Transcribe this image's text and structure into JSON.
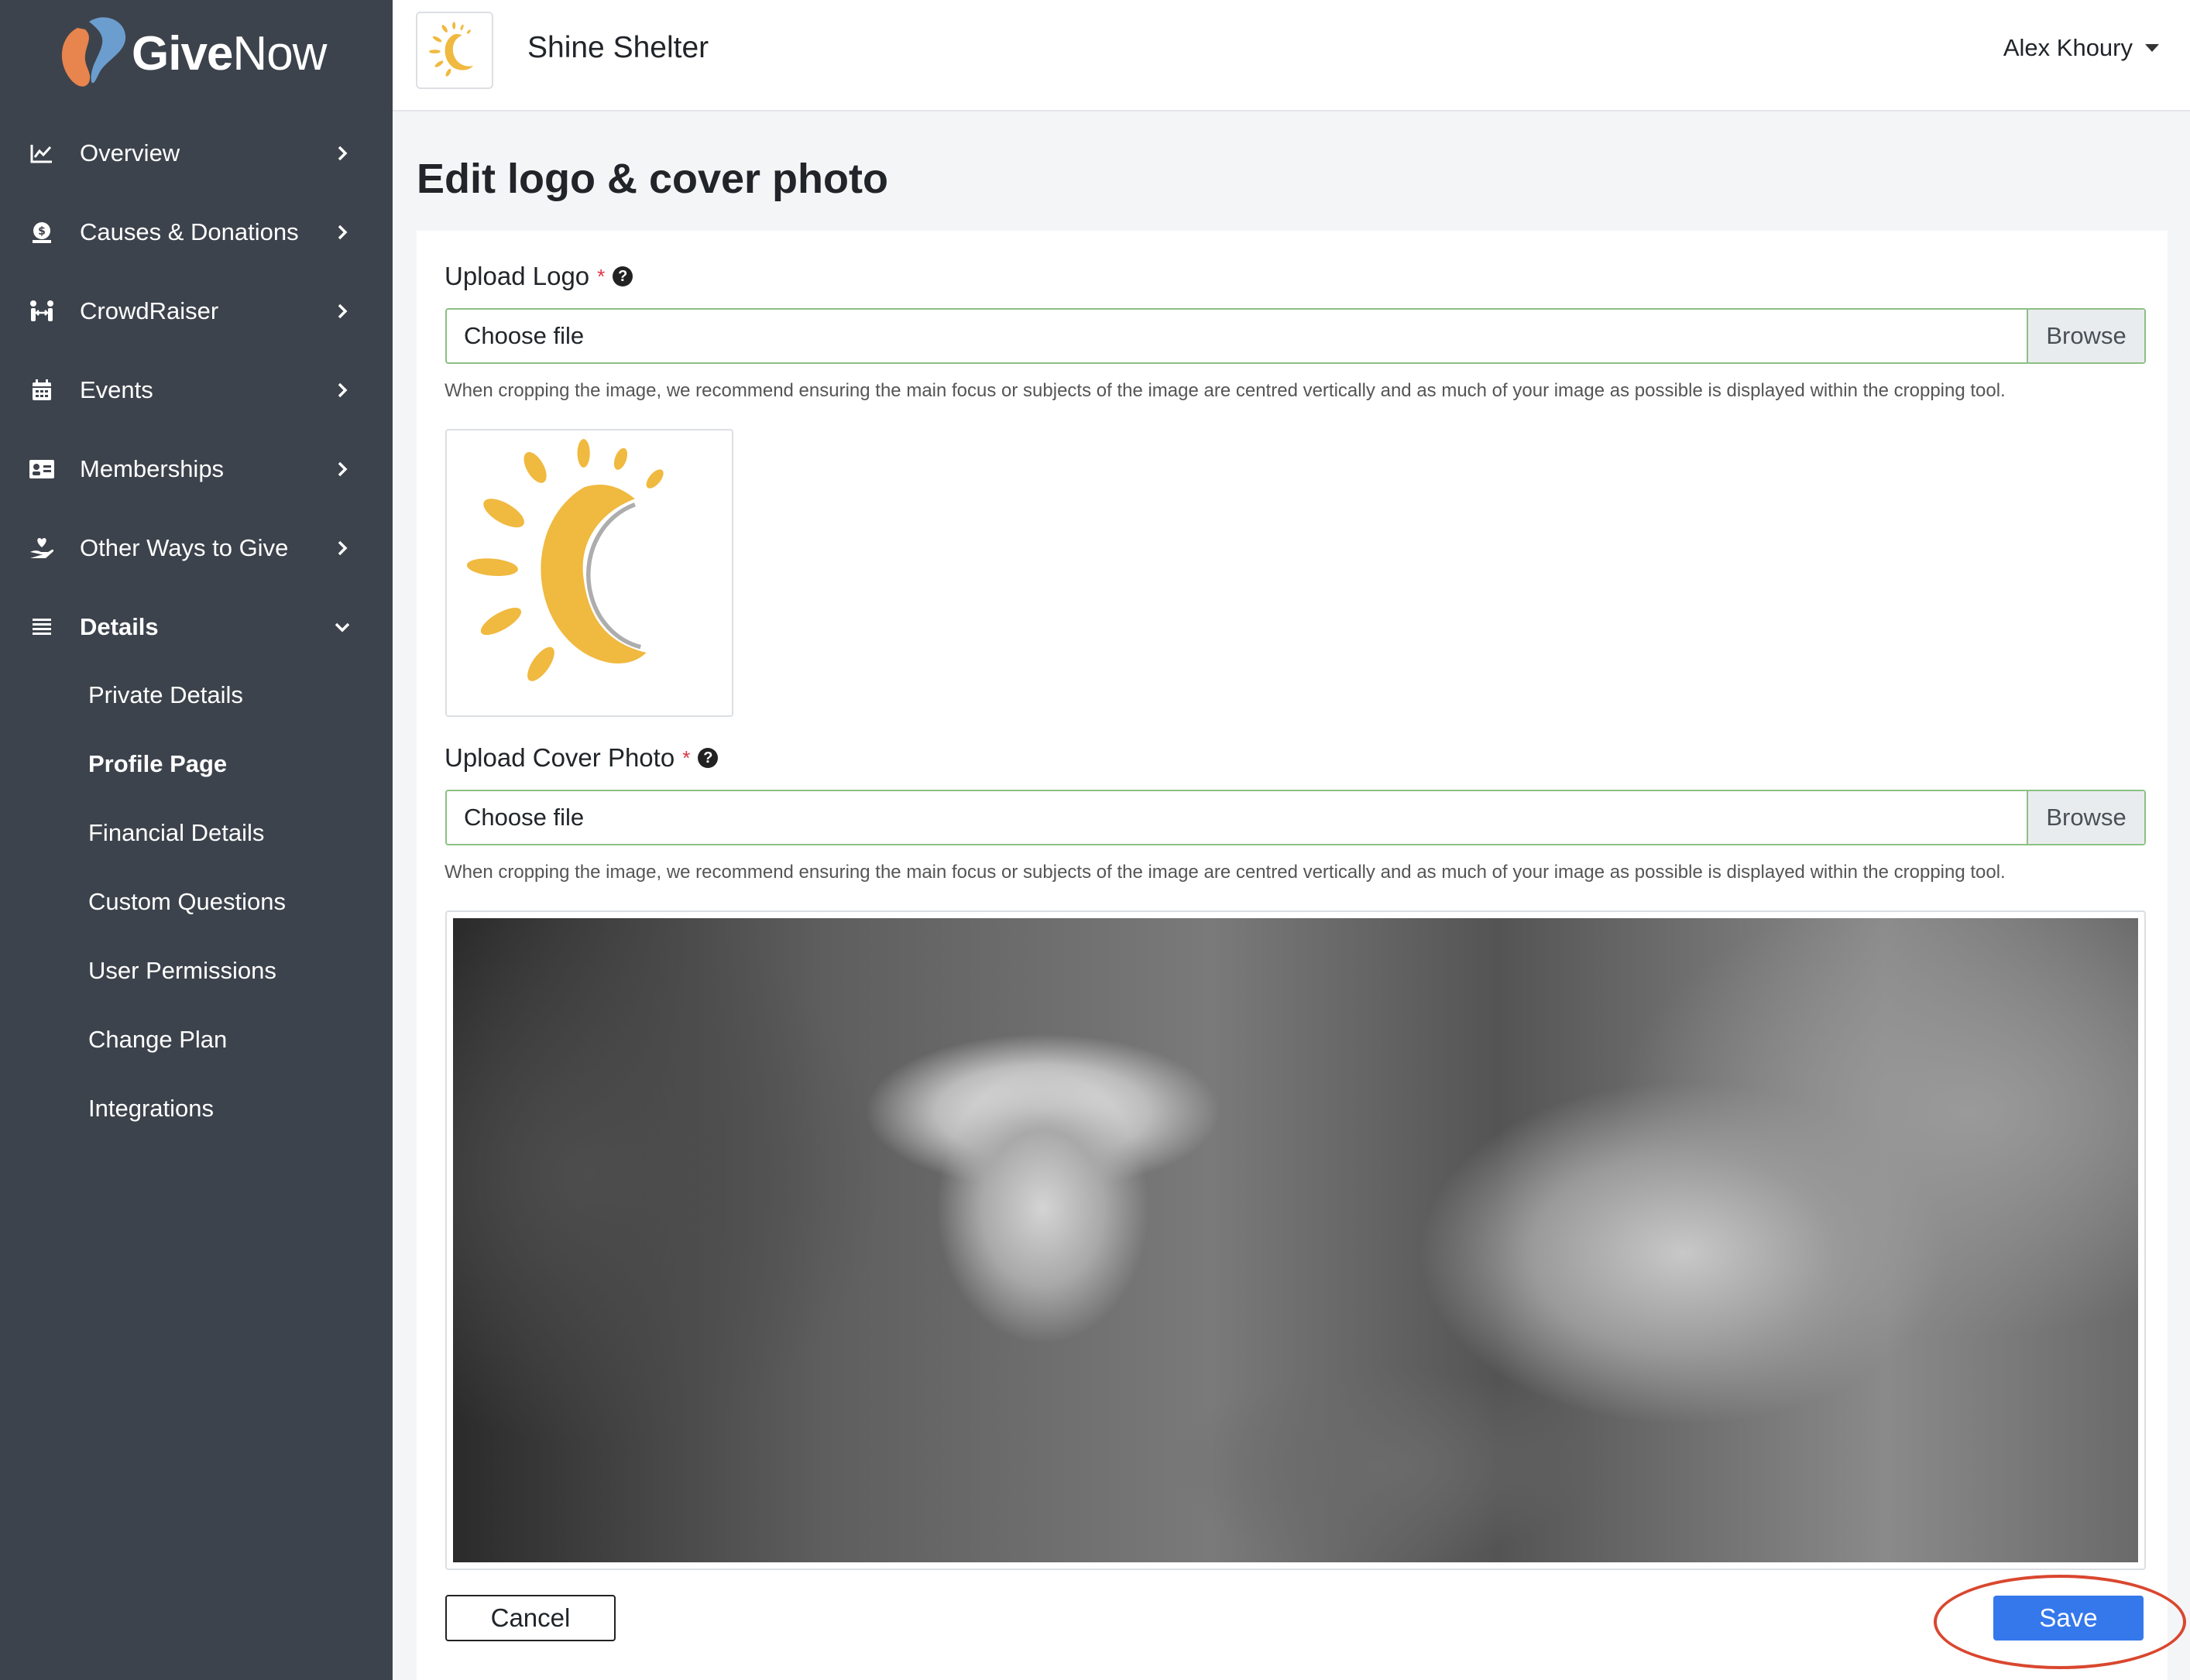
{
  "app": {
    "brand_bold": "Give",
    "brand_light": "Now",
    "org_name": "Shine Shelter",
    "user_name": "Alex Khoury"
  },
  "sidebar": {
    "items": [
      {
        "label": "Overview",
        "icon": "chart-line-icon"
      },
      {
        "label": "Causes & Donations",
        "icon": "money-bag-icon"
      },
      {
        "label": "CrowdRaiser",
        "icon": "people-arrows-icon"
      },
      {
        "label": "Events",
        "icon": "calendar-icon"
      },
      {
        "label": "Memberships",
        "icon": "id-card-icon"
      },
      {
        "label": "Other Ways to Give",
        "icon": "hand-heart-icon"
      },
      {
        "label": "Details",
        "icon": "list-icon"
      }
    ],
    "sub_items": [
      "Private Details",
      "Profile Page",
      "Financial Details",
      "Custom Questions",
      "User Permissions",
      "Change Plan",
      "Integrations"
    ]
  },
  "main": {
    "title": "Edit logo & cover photo",
    "logo_field": {
      "label": "Upload Logo",
      "required": "*",
      "help": "?",
      "file_text": "Choose file",
      "browse": "Browse",
      "hint": "When cropping the image, we recommend ensuring the main focus or subjects of the image are centred vertically and as much of your image as possible is displayed within the cropping tool."
    },
    "cover_field": {
      "label": "Upload Cover Photo",
      "required": "*",
      "help": "?",
      "file_text": "Choose file",
      "browse": "Browse",
      "hint": "When cropping the image, we recommend ensuring the main focus or subjects of the image are centred vertically and as much of your image as possible is displayed within the cropping tool."
    },
    "cancel_label": "Cancel",
    "save_label": "Save"
  },
  "colors": {
    "sidebar_bg": "#3d434c",
    "primary": "#3578ec",
    "field_border": "#8cc084",
    "annotation": "#d9472f",
    "logo_sun": "#f0b93f"
  }
}
